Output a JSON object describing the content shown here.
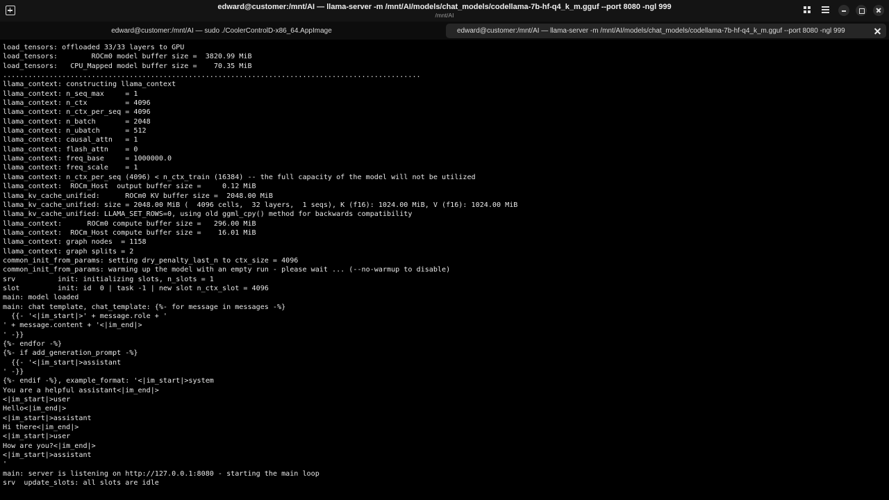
{
  "titlebar": {
    "title": "edward@customer:/mnt/AI — llama-server -m /mnt/AI/models/chat_models/codellama-7b-hf-q4_k_m.gguf --port 8080 -ngl 999",
    "subtitle": "/mnt/AI"
  },
  "tabs": [
    {
      "label": "edward@customer:/mnt/AI — sudo ./CoolerControlD-x86_64.AppImage"
    },
    {
      "label": "edward@customer:/mnt/AI — llama-server -m /mnt/AI/models/chat_models/codellama-7b-hf-q4_k_m.gguf --port 8080 -ngl 999"
    }
  ],
  "icons": {
    "new_tab": "new-tab-icon",
    "grid": "grid-view-icon",
    "menu": "hamburger-menu-icon",
    "minimize": "minimize-icon",
    "maximize": "maximize-icon",
    "close": "close-icon"
  },
  "colors": {
    "background": "#000000",
    "text": "#e8e8e8",
    "titlebar": "#141414",
    "active_tab": "#262626"
  },
  "terminal": {
    "lines": [
      "load_tensors: offloaded 33/33 layers to GPU",
      "load_tensors:        ROCm0 model buffer size =  3820.99 MiB",
      "load_tensors:   CPU_Mapped model buffer size =    70.35 MiB",
      "...................................................................................................",
      "llama_context: constructing llama_context",
      "llama_context: n_seq_max     = 1",
      "llama_context: n_ctx         = 4096",
      "llama_context: n_ctx_per_seq = 4096",
      "llama_context: n_batch       = 2048",
      "llama_context: n_ubatch      = 512",
      "llama_context: causal_attn   = 1",
      "llama_context: flash_attn    = 0",
      "llama_context: freq_base     = 1000000.0",
      "llama_context: freq_scale    = 1",
      "llama_context: n_ctx_per_seq (4096) < n_ctx_train (16384) -- the full capacity of the model will not be utilized",
      "llama_context:  ROCm_Host  output buffer size =     0.12 MiB",
      "llama_kv_cache_unified:      ROCm0 KV buffer size =  2048.00 MiB",
      "llama_kv_cache_unified: size = 2048.00 MiB (  4096 cells,  32 layers,  1 seqs), K (f16): 1024.00 MiB, V (f16): 1024.00 MiB",
      "llama_kv_cache_unified: LLAMA_SET_ROWS=0, using old ggml_cpy() method for backwards compatibility",
      "llama_context:      ROCm0 compute buffer size =   296.00 MiB",
      "llama_context:  ROCm_Host compute buffer size =    16.01 MiB",
      "llama_context: graph nodes  = 1158",
      "llama_context: graph splits = 2",
      "common_init_from_params: setting dry_penalty_last_n to ctx_size = 4096",
      "common_init_from_params: warming up the model with an empty run - please wait ... (--no-warmup to disable)",
      "srv          init: initializing slots, n_slots = 1",
      "slot         init: id  0 | task -1 | new slot n_ctx_slot = 4096",
      "main: model loaded",
      "main: chat template, chat_template: {%- for message in messages -%}",
      "  {{- '<|im_start|>' + message.role + '",
      "' + message.content + '<|im_end|>",
      "' -}}",
      "{%- endfor -%}",
      "{%- if add_generation_prompt -%}",
      "  {{- '<|im_start|>assistant",
      "' -}}",
      "{%- endif -%}, example_format: '<|im_start|>system",
      "You are a helpful assistant<|im_end|>",
      "<|im_start|>user",
      "Hello<|im_end|>",
      "<|im_start|>assistant",
      "Hi there<|im_end|>",
      "<|im_start|>user",
      "How are you?<|im_end|>",
      "<|im_start|>assistant",
      "'",
      "main: server is listening on http://127.0.0.1:8080 - starting the main loop",
      "srv  update_slots: all slots are idle"
    ]
  }
}
